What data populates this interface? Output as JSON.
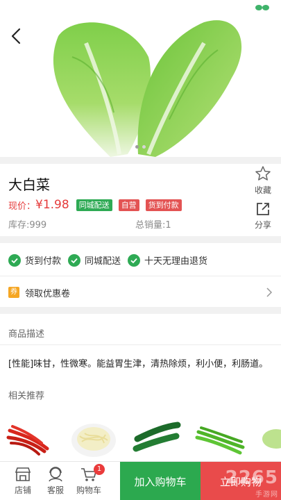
{
  "product": {
    "name": "大白菜",
    "price_label": "现价：",
    "price_value": "¥1.98",
    "tags": [
      "同城配送",
      "自营",
      "货到付款"
    ],
    "stock": "库存:999",
    "sales": "总销量:1"
  },
  "actions": {
    "favorite": "收藏",
    "share": "分享"
  },
  "guarantees": [
    "货到付款",
    "同城配送",
    "十天无理由退货"
  ],
  "coupon": {
    "badge": "券",
    "label": "领取优惠卷"
  },
  "sections": {
    "description_title": "商品描述",
    "recommend_title": "相关推荐"
  },
  "description": "[性能]味甘，性微寒。能益胃生津，清热除烦，利小便，利肠道。",
  "bottom_bar": {
    "store": "店铺",
    "service": "客服",
    "cart": "购物车",
    "cart_count": "1",
    "add_to_cart": "加入购物车",
    "buy_now": "立即购物"
  },
  "watermark": {
    "brand": "2265",
    "sub": "手游网"
  },
  "colors": {
    "price": "#e53a3a",
    "green": "#2ca94f",
    "red": "#e94b4b",
    "tag_green": "#2eaa54",
    "tag_red": "#e35353"
  },
  "icons": [
    "back-icon",
    "star-icon",
    "share-icon",
    "check-icon",
    "coupon-icon",
    "chevron-right-icon",
    "store-icon",
    "service-icon",
    "cart-icon"
  ]
}
